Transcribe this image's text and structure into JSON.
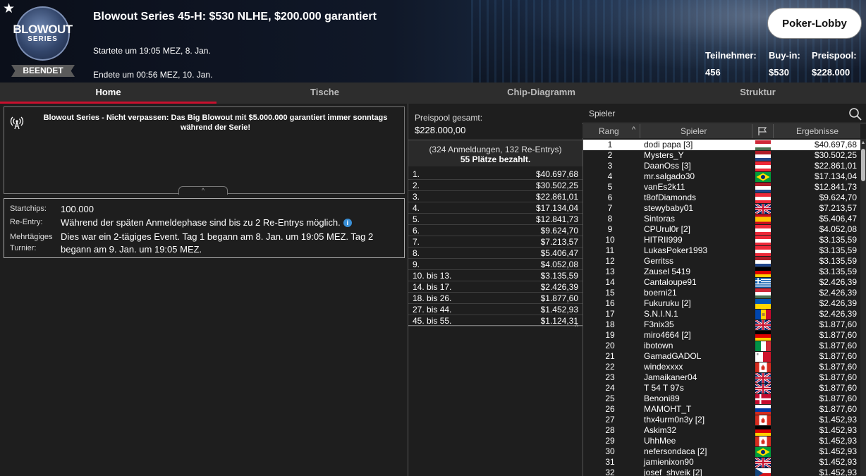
{
  "header": {
    "star": "★",
    "logo_line1": "BLOWOUT",
    "logo_line2": "SERIES",
    "status": "BEENDET",
    "title": "Blowout Series 45-H: $530 NLHE, $200.000 garantiert",
    "started": "Startete um 19:05 MEZ, 8. Jan.",
    "ended": "Endete um 00:56 MEZ, 10. Jan.",
    "lobby_button": "Poker-Lobby",
    "stats": [
      {
        "label": "Teilnehmer:",
        "value": "456"
      },
      {
        "label": "Buy-in:",
        "value": "$530"
      },
      {
        "label": "Preispool:",
        "value": "$228.000"
      }
    ]
  },
  "tabs": [
    "Home",
    "Tische",
    "Chip-Diagramm",
    "Struktur"
  ],
  "news": {
    "text": "Blowout Series - Nicht verpassen: Das Big Blowout mit $5.000.000 garantiert immer sonntags während der Serie!",
    "collapse": "^"
  },
  "info": {
    "startchips_label": "Startchips:",
    "startchips_value": "100.000",
    "reentry_label": "Re-Entry:",
    "reentry_value": "Während der späten Anmeldephase sind bis zu 2 Re-Entrys möglich.",
    "info_icon": "i",
    "multiday_label": "Mehrtägiges Turnier:",
    "multiday_value": "Dies war ein 2-tägiges Event. Tag 1 begann am 8. Jan. um 19:05 MEZ. Tag 2 begann am 9. Jan. um 19:05 MEZ."
  },
  "prizepool": {
    "label": "Preispool gesamt:",
    "value": "$228.000,00",
    "registrations": "(324 Anmeldungen, 132 Re-Entrys)",
    "paid": "55 Plätze bezahlt.",
    "collapse": "^",
    "payouts": [
      {
        "place": "1.",
        "amount": "$40.697,68"
      },
      {
        "place": "2.",
        "amount": "$30.502,25"
      },
      {
        "place": "3.",
        "amount": "$22.861,01"
      },
      {
        "place": "4.",
        "amount": "$17.134,04"
      },
      {
        "place": "5.",
        "amount": "$12.841,73"
      },
      {
        "place": "6.",
        "amount": "$9.624,70"
      },
      {
        "place": "7.",
        "amount": "$7.213,57"
      },
      {
        "place": "8.",
        "amount": "$5.406,47"
      },
      {
        "place": "9.",
        "amount": "$4.052,08"
      },
      {
        "place": "10. bis 13.",
        "amount": "$3.135,59"
      },
      {
        "place": "14. bis 17.",
        "amount": "$2.426,39"
      },
      {
        "place": "18. bis 26.",
        "amount": "$1.877,60"
      },
      {
        "place": "27. bis 44.",
        "amount": "$1.452,93"
      },
      {
        "place": "45. bis 55.",
        "amount": "$1.124,31"
      }
    ]
  },
  "players": {
    "search_placeholder": "Spieler",
    "columns": {
      "rank": "Rang",
      "sort": "^",
      "player": "Spieler",
      "results": "Ergebnisse"
    },
    "scroll_up": "▲",
    "rows": [
      {
        "rank": "1",
        "name": "dodi papa [3]",
        "flag": "hu",
        "result": "$40.697,68"
      },
      {
        "rank": "2",
        "name": "Mysters_Y",
        "flag": "nl",
        "result": "$30.502,25"
      },
      {
        "rank": "3",
        "name": "DaanOss [3]",
        "flag": "at",
        "result": "$22.861,01"
      },
      {
        "rank": "4",
        "name": "mr.salgado30",
        "flag": "br",
        "result": "$17.134,04"
      },
      {
        "rank": "5",
        "name": "vanEs2k11",
        "flag": "nl",
        "result": "$12.841,73"
      },
      {
        "rank": "6",
        "name": "t8ofDiamonds",
        "flag": "at",
        "result": "$9.624,70"
      },
      {
        "rank": "7",
        "name": "stewybaby01",
        "flag": "gb",
        "result": "$7.213,57"
      },
      {
        "rank": "8",
        "name": "Sintoras",
        "flag": "es",
        "result": "$5.406,47"
      },
      {
        "rank": "9",
        "name": "CPUrul0r [2]",
        "flag": "at",
        "result": "$4.052,08"
      },
      {
        "rank": "10",
        "name": "HITRII999",
        "flag": "at",
        "result": "$3.135,59"
      },
      {
        "rank": "11",
        "name": "LukasPoker1993",
        "flag": "at",
        "result": "$3.135,59"
      },
      {
        "rank": "12",
        "name": "Gerritss",
        "flag": "nl",
        "result": "$3.135,59"
      },
      {
        "rank": "13",
        "name": "Zausel 5419",
        "flag": "de",
        "result": "$3.135,59"
      },
      {
        "rank": "14",
        "name": "Cantaloupe91",
        "flag": "gr",
        "result": "$2.426,39"
      },
      {
        "rank": "15",
        "name": "boerni21",
        "flag": "hu",
        "result": "$2.426,39"
      },
      {
        "rank": "16",
        "name": "Fukuruku [2]",
        "flag": "ua",
        "result": "$2.426,39"
      },
      {
        "rank": "17",
        "name": "S.N.I.N.1",
        "flag": "md",
        "result": "$2.426,39"
      },
      {
        "rank": "18",
        "name": "F3nix35",
        "flag": "gb",
        "result": "$1.877,60"
      },
      {
        "rank": "19",
        "name": "miro4664 [2]",
        "flag": "de",
        "result": "$1.877,60"
      },
      {
        "rank": "20",
        "name": "ibotown",
        "flag": "it",
        "result": "$1.877,60"
      },
      {
        "rank": "21",
        "name": "GamadGADOL",
        "flag": "mt",
        "result": "$1.877,60"
      },
      {
        "rank": "22",
        "name": "windexxxx",
        "flag": "ca",
        "result": "$1.877,60"
      },
      {
        "rank": "23",
        "name": "Jamaikaner04",
        "flag": "gb",
        "result": "$1.877,60"
      },
      {
        "rank": "24",
        "name": "T 54 T 97s",
        "flag": "gb",
        "result": "$1.877,60"
      },
      {
        "rank": "25",
        "name": "Benoni89",
        "flag": "dk",
        "result": "$1.877,60"
      },
      {
        "rank": "26",
        "name": "MAMOHT_T",
        "flag": "ru",
        "result": "$1.877,60"
      },
      {
        "rank": "27",
        "name": "thx4urm0n3y [2]",
        "flag": "ca",
        "result": "$1.452,93"
      },
      {
        "rank": "28",
        "name": "Askim32",
        "flag": "de",
        "result": "$1.452,93"
      },
      {
        "rank": "29",
        "name": "UhhMee",
        "flag": "ca",
        "result": "$1.452,93"
      },
      {
        "rank": "30",
        "name": "nefersondaca [2]",
        "flag": "br",
        "result": "$1.452,93"
      },
      {
        "rank": "31",
        "name": "jamienixon90",
        "flag": "gb",
        "result": "$1.452,93"
      },
      {
        "rank": "32",
        "name": "josef_shveik [2]",
        "flag": "cz",
        "result": "$1.452,93"
      }
    ]
  }
}
